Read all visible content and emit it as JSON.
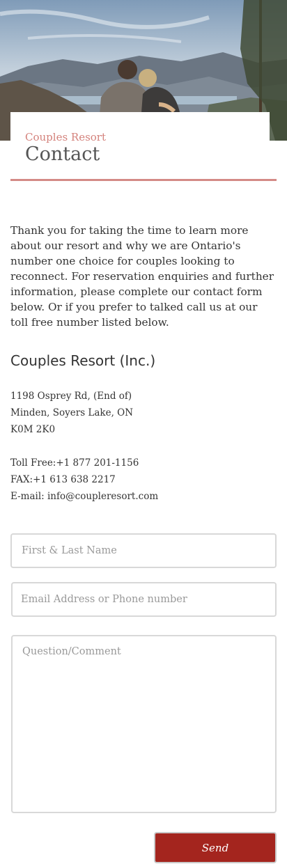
{
  "header": {
    "subtitle": "Couples Resort",
    "title": "Contact"
  },
  "intro": {
    "text": "Thank you for taking the time to learn more about our resort and why we are Ontario's number one choice for couples looking to reconnect.  For reservation enquiries and further information, please complete our contact form below.  Or if you prefer to talked call us at our toll free number listed below."
  },
  "contact": {
    "company": "Couples Resort (Inc.)",
    "address_line1": "1198 Osprey Rd, (End of)",
    "address_line2": "Minden, Soyers Lake, ON",
    "address_line3": "K0M 2K0",
    "toll_free": "Toll Free:+1 877 201-1156",
    "fax": "FAX:+1 613 638 2217",
    "email": "E-mail: info@coupleresort.com"
  },
  "form": {
    "name_placeholder": "First & Last Name",
    "email_placeholder": "Email Address or Phone number",
    "comment_placeholder": "Question/Comment",
    "send_label": "Send"
  },
  "colors": {
    "accent": "#d4827c",
    "button": "#a4251e"
  }
}
